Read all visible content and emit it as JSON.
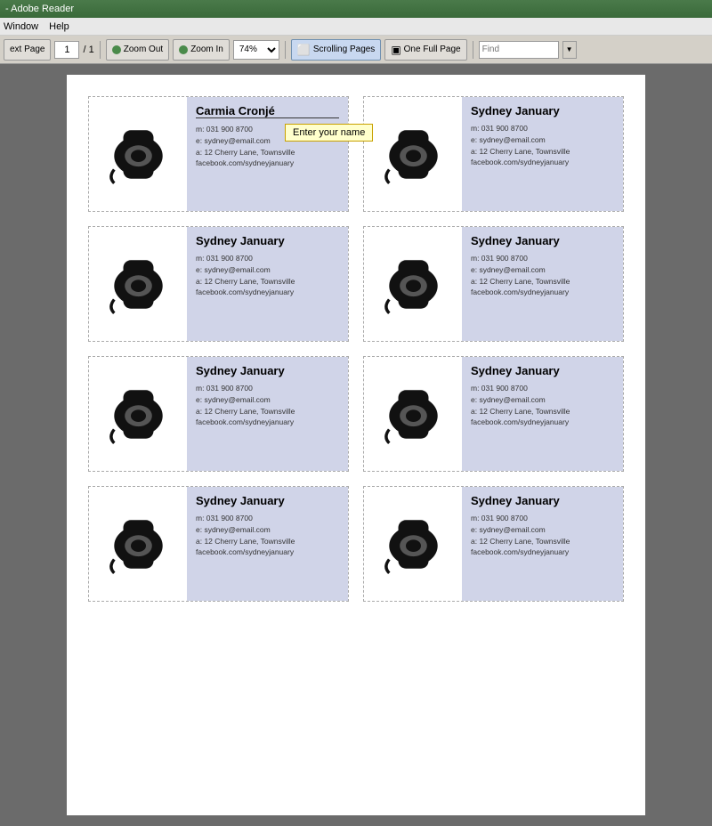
{
  "titleBar": {
    "text": "- Adobe Reader"
  },
  "menuBar": {
    "items": [
      "Window",
      "Help"
    ]
  },
  "toolbar": {
    "prevBtn": "ext Page",
    "pageInput": "1",
    "pageTotal": "/ 1",
    "zoomOut": "Zoom Out",
    "zoomIn": "Zoom In",
    "zoomLevel": "74%",
    "scrollingPages": "Scrolling Pages",
    "oneFullPage": "One Full Page",
    "findPlaceholder": "Find"
  },
  "cards": [
    {
      "id": "card-1",
      "name": "Carmia Cronjé",
      "isInput": true,
      "showTooltip": true,
      "tooltipText": "Enter your name",
      "phone": "031 900 8700",
      "email": "sydney@email.com",
      "address": "12 Cherry Lane, Townsville",
      "facebook": "facebook.com/sydneyjanuary"
    },
    {
      "id": "card-2",
      "name": "Sydney January",
      "isInput": false,
      "showTooltip": false,
      "phone": "031 900 8700",
      "email": "sydney@email.com",
      "address": "12 Cherry Lane, Townsville",
      "facebook": "facebook.com/sydneyjanuary"
    },
    {
      "id": "card-3",
      "name": "Sydney January",
      "isInput": false,
      "showTooltip": false,
      "phone": "031 900 8700",
      "email": "sydney@email.com",
      "address": "12 Cherry Lane, Townsville",
      "facebook": "facebook.com/sydneyjanuary"
    },
    {
      "id": "card-4",
      "name": "Sydney January",
      "isInput": false,
      "showTooltip": false,
      "phone": "031 900 8700",
      "email": "sydney@email.com",
      "address": "12 Cherry Lane, Townsville",
      "facebook": "facebook.com/sydneyjanuary"
    },
    {
      "id": "card-5",
      "name": "Sydney January",
      "isInput": false,
      "showTooltip": false,
      "phone": "031 900 8700",
      "email": "sydney@email.com",
      "address": "12 Cherry Lane, Townsville",
      "facebook": "facebook.com/sydneyjanuary"
    },
    {
      "id": "card-6",
      "name": "Sydney January",
      "isInput": false,
      "showTooltip": false,
      "phone": "031 900 8700",
      "email": "sydney@email.com",
      "address": "12 Cherry Lane, Townsville",
      "facebook": "facebook.com/sydneyjanuary"
    },
    {
      "id": "card-7",
      "name": "Sydney January",
      "isInput": false,
      "showTooltip": false,
      "phone": "031 900 8700",
      "email": "sydney@email.com",
      "address": "12 Cherry Lane, Townsville",
      "facebook": "facebook.com/sydneyjanuary"
    },
    {
      "id": "card-8",
      "name": "Sydney January",
      "isInput": false,
      "showTooltip": false,
      "phone": "031 900 8700",
      "email": "sydney@email.com",
      "address": "12 Cherry Lane, Townsville",
      "facebook": "facebook.com/sydneyjanuary"
    }
  ],
  "labels": {
    "phone_prefix": "m:",
    "email_prefix": "e:",
    "address_prefix": "a:",
    "facebook_prefix": ""
  }
}
